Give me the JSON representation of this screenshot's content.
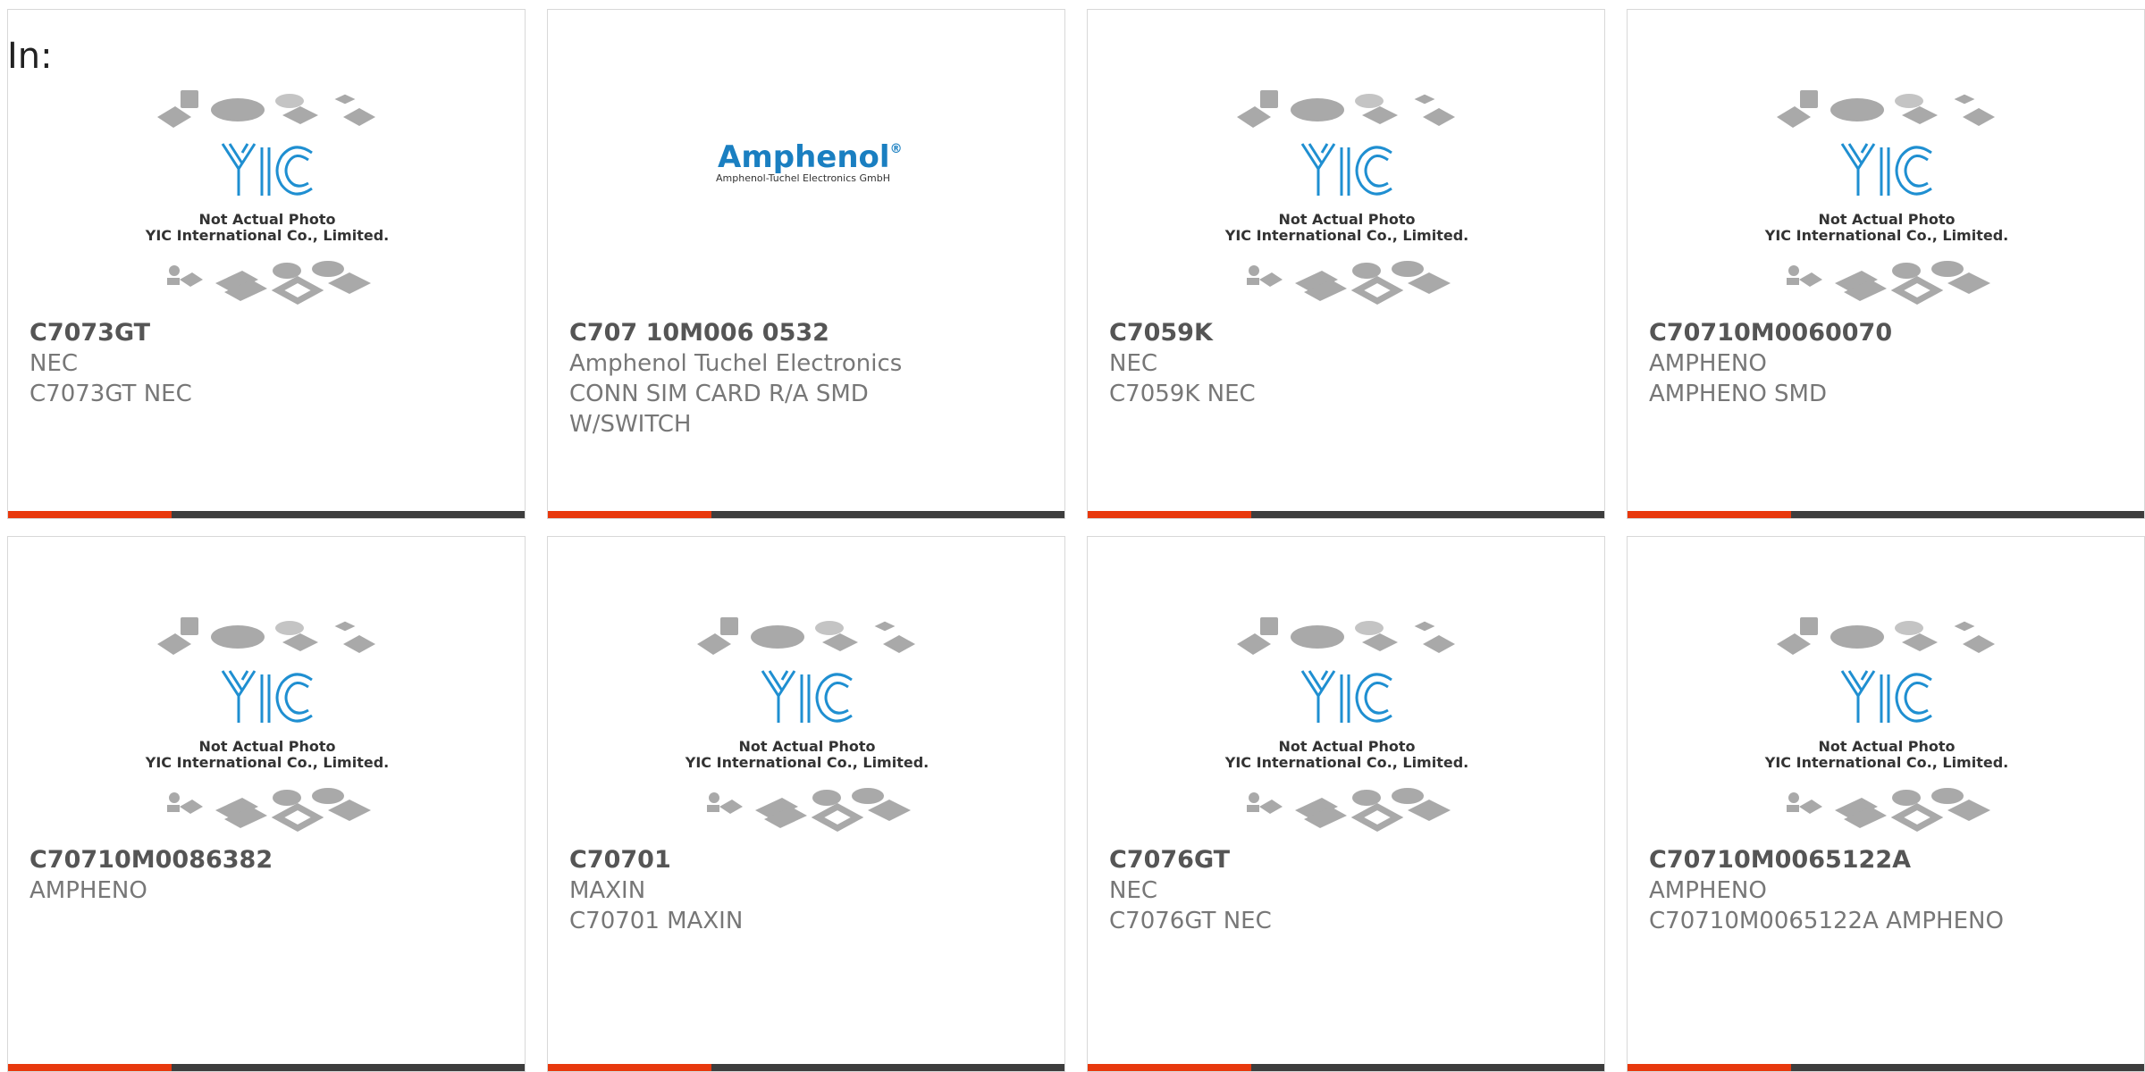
{
  "filter_label": "In:",
  "placeholder": {
    "caption_line1": "Not Actual Photo",
    "caption_line2": "YIC International Co., Limited."
  },
  "amphenol_logo": {
    "brand": "Amphenol",
    "subtitle": "Amphenol-Tuchel Electronics GmbH"
  },
  "colors": {
    "accent": "#e8380d",
    "bar": "#3d3d3d",
    "logo_blue": "#1f8fd1",
    "amphenol_blue": "#1a7fc1"
  },
  "cards": [
    {
      "part": "C7073GT",
      "lines": [
        "NEC",
        "C7073GT NEC"
      ],
      "image": "placeholder"
    },
    {
      "part": "C707 10M006 0532",
      "lines": [
        "Amphenol Tuchel Electronics",
        "CONN SIM CARD R/A SMD",
        "W/SWITCH"
      ],
      "image": "amphenol-logo"
    },
    {
      "part": "C7059K",
      "lines": [
        "NEC",
        "C7059K NEC"
      ],
      "image": "placeholder"
    },
    {
      "part": "C70710M0060070",
      "lines": [
        "AMPHENO",
        "AMPHENO SMD"
      ],
      "image": "placeholder"
    },
    {
      "part": "C70710M0086382",
      "lines": [
        "AMPHENO"
      ],
      "image": "placeholder"
    },
    {
      "part": "C70701",
      "lines": [
        "MAXIN",
        "C70701 MAXIN"
      ],
      "image": "placeholder"
    },
    {
      "part": "C7076GT",
      "lines": [
        "NEC",
        "C7076GT NEC"
      ],
      "image": "placeholder"
    },
    {
      "part": "C70710M0065122A",
      "lines": [
        "AMPHENO",
        "C70710M0065122A AMPHENO"
      ],
      "image": "placeholder"
    }
  ]
}
